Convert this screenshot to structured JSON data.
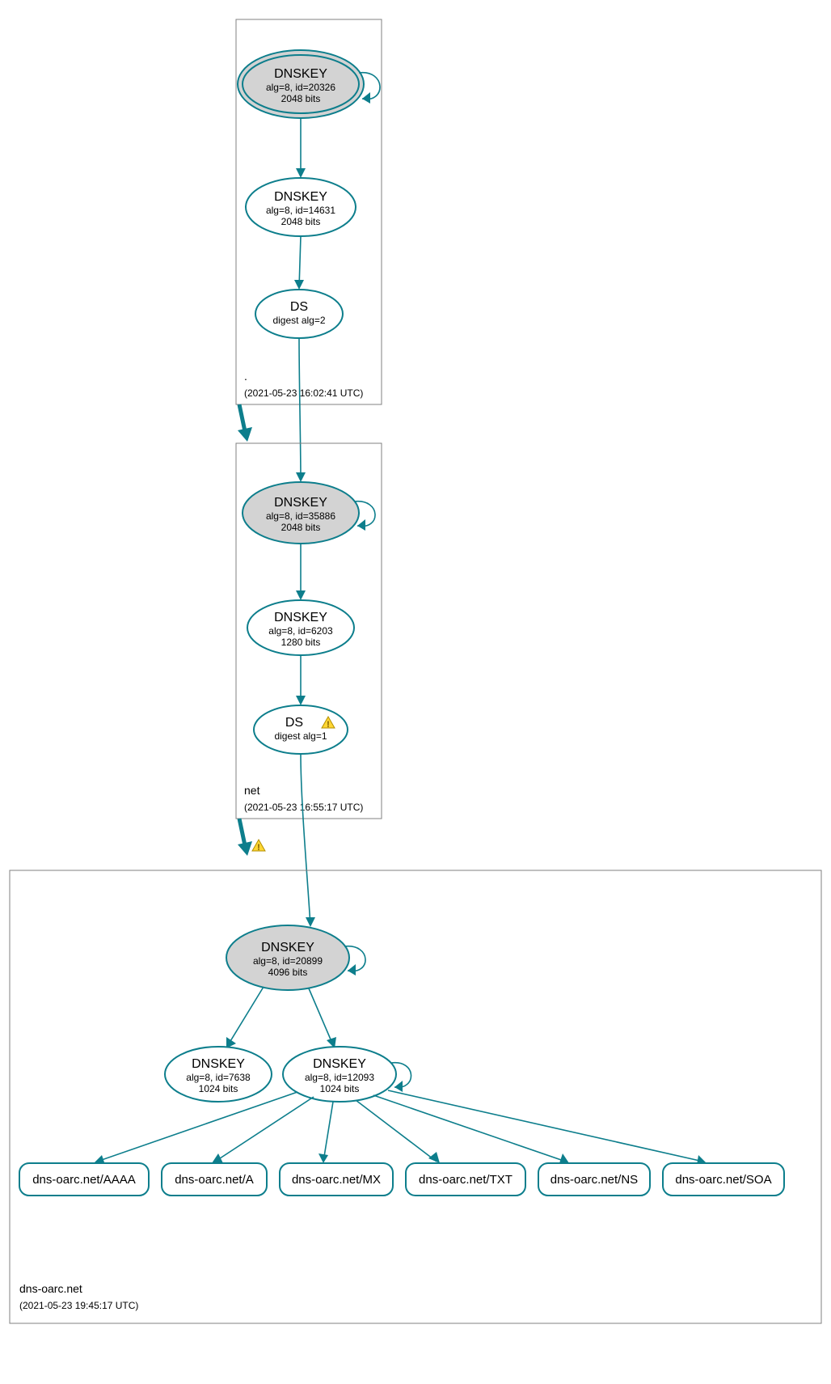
{
  "zones": {
    "root": {
      "name": ".",
      "timestamp": "(2021-05-23 16:02:41 UTC)"
    },
    "net": {
      "name": "net",
      "timestamp": "(2021-05-23 16:55:17 UTC)"
    },
    "dnsoarc": {
      "name": "dns-oarc.net",
      "timestamp": "(2021-05-23 19:45:17 UTC)"
    }
  },
  "nodes": {
    "root_ksk": {
      "title": "DNSKEY",
      "line2": "alg=8, id=20326",
      "line3": "2048 bits"
    },
    "root_zsk": {
      "title": "DNSKEY",
      "line2": "alg=8, id=14631",
      "line3": "2048 bits"
    },
    "root_ds": {
      "title": "DS",
      "line2": "digest alg=2"
    },
    "net_ksk": {
      "title": "DNSKEY",
      "line2": "alg=8, id=35886",
      "line3": "2048 bits"
    },
    "net_zsk": {
      "title": "DNSKEY",
      "line2": "alg=8, id=6203",
      "line3": "1280 bits"
    },
    "net_ds": {
      "title": "DS",
      "line2": "digest alg=1"
    },
    "oarc_ksk": {
      "title": "DNSKEY",
      "line2": "alg=8, id=20899",
      "line3": "4096 bits"
    },
    "oarc_zsk1": {
      "title": "DNSKEY",
      "line2": "alg=8, id=7638",
      "line3": "1024 bits"
    },
    "oarc_zsk2": {
      "title": "DNSKEY",
      "line2": "alg=8, id=12093",
      "line3": "1024 bits"
    }
  },
  "rrsets": {
    "aaaa": "dns-oarc.net/AAAA",
    "a": "dns-oarc.net/A",
    "mx": "dns-oarc.net/MX",
    "txt": "dns-oarc.net/TXT",
    "ns": "dns-oarc.net/NS",
    "soa": "dns-oarc.net/SOA"
  }
}
